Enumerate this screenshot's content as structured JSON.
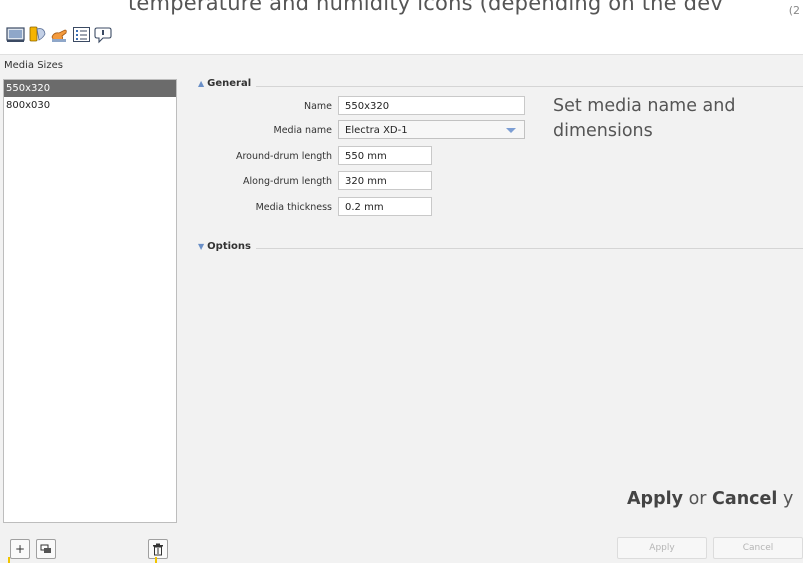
{
  "overlay": {
    "top_text": "temperature and humidity icons (depending on the dev",
    "corner_text": "(2",
    "note_media": "Set media name and dimensions",
    "note_media_line1": "Set media name and",
    "note_media_line2": "dimensions",
    "note_apply_bold1": "Apply",
    "note_apply_mid": " or ",
    "note_apply_bold2": "Cancel",
    "note_apply_tail": " y"
  },
  "toolbar": {
    "icons": [
      "monitor-icon",
      "media-tools-icon",
      "hand-icon",
      "list-icon",
      "chat-icon"
    ]
  },
  "media_sizes": {
    "label": "Media Sizes",
    "items": [
      {
        "label": "550x320",
        "selected": true
      },
      {
        "label": "800x030",
        "selected": false
      }
    ],
    "add_button": "+",
    "copy_button": "⧉",
    "delete_button": "🗑"
  },
  "general": {
    "title": "General",
    "fields": {
      "name_label": "Name",
      "name_value": "550x320",
      "media_name_label": "Media name",
      "media_name_value": "Electra XD-1",
      "around_label": "Around-drum length",
      "around_value": "550 mm",
      "along_label": "Along-drum length",
      "along_value": "320 mm",
      "thickness_label": "Media thickness",
      "thickness_value": "0.2 mm"
    }
  },
  "options": {
    "title": "Options"
  },
  "actions": {
    "apply": "Apply",
    "cancel": "Cancel"
  },
  "colors": {
    "selection": "#6b6b6b",
    "accent_yellow": "#f1c400",
    "arrow_blue": "#6a8fc7"
  }
}
